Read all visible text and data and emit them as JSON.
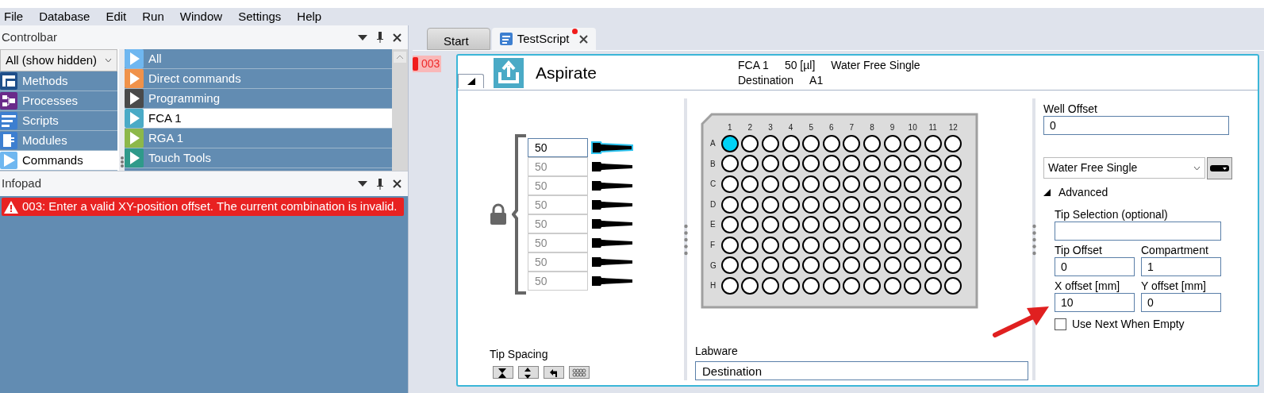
{
  "menu": [
    "File",
    "Database",
    "Edit",
    "Run",
    "Window",
    "Settings",
    "Help"
  ],
  "controlbar": {
    "title": "Controlbar",
    "filter": "All (show hidden)",
    "categories": [
      {
        "label": "Methods",
        "kind": "methods",
        "selected": false
      },
      {
        "label": "Processes",
        "kind": "processes",
        "selected": false
      },
      {
        "label": "Scripts",
        "kind": "scripts",
        "selected": false
      },
      {
        "label": "Modules",
        "kind": "modules",
        "selected": false
      },
      {
        "label": "Commands",
        "kind": "commands",
        "selected": true
      }
    ],
    "commands": [
      {
        "label": "All",
        "color": "#6fb7f0",
        "selected": false
      },
      {
        "label": "Direct commands",
        "color": "#f0924a",
        "selected": false
      },
      {
        "label": "Programming",
        "color": "#4a4a4a",
        "selected": false
      },
      {
        "label": "FCA 1",
        "color": "#4aaac6",
        "selected": true
      },
      {
        "label": "RGA 1",
        "color": "#8db84a",
        "selected": false
      },
      {
        "label": "Touch Tools",
        "color": "#2f9a8a",
        "selected": false
      }
    ]
  },
  "infopad": {
    "title": "Infopad",
    "messages": [
      {
        "text": "003: Enter a valid XY-position offset. The current combination is invalid."
      }
    ]
  },
  "tabs": [
    {
      "label": "Start",
      "selected": false,
      "modified": false,
      "closable": false
    },
    {
      "label": "TestScript",
      "selected": true,
      "modified": true,
      "closable": true
    }
  ],
  "step_marker": "003",
  "step": {
    "title": "Aspirate",
    "expanded": true,
    "summary": [
      [
        "FCA 1",
        "50 [µl]",
        "Water Free Single"
      ],
      [
        "Destination",
        "A1"
      ]
    ],
    "volumes": [
      {
        "value": "50",
        "selected": true
      },
      {
        "value": "50",
        "selected": false
      },
      {
        "value": "50",
        "selected": false
      },
      {
        "value": "50",
        "selected": false
      },
      {
        "value": "50",
        "selected": false
      },
      {
        "value": "50",
        "selected": false
      },
      {
        "value": "50",
        "selected": false
      },
      {
        "value": "50",
        "selected": false
      }
    ],
    "tip_spacing": "Tip Spacing",
    "plate": {
      "columns": [
        "1",
        "2",
        "3",
        "4",
        "5",
        "6",
        "7",
        "8",
        "9",
        "10",
        "11",
        "12"
      ],
      "rows": [
        {
          "label": "A",
          "wells": [
            {
              "selected": true
            },
            {
              "selected": false
            },
            {
              "selected": false
            },
            {
              "selected": false
            },
            {
              "selected": false
            },
            {
              "selected": false
            },
            {
              "selected": false
            },
            {
              "selected": false
            },
            {
              "selected": false
            },
            {
              "selected": false
            },
            {
              "selected": false
            },
            {
              "selected": false
            }
          ]
        },
        {
          "label": "B",
          "wells": [
            {
              "selected": false
            },
            {
              "selected": false
            },
            {
              "selected": false
            },
            {
              "selected": false
            },
            {
              "selected": false
            },
            {
              "selected": false
            },
            {
              "selected": false
            },
            {
              "selected": false
            },
            {
              "selected": false
            },
            {
              "selected": false
            },
            {
              "selected": false
            },
            {
              "selected": false
            }
          ]
        },
        {
          "label": "C",
          "wells": [
            {
              "selected": false
            },
            {
              "selected": false
            },
            {
              "selected": false
            },
            {
              "selected": false
            },
            {
              "selected": false
            },
            {
              "selected": false
            },
            {
              "selected": false
            },
            {
              "selected": false
            },
            {
              "selected": false
            },
            {
              "selected": false
            },
            {
              "selected": false
            },
            {
              "selected": false
            }
          ]
        },
        {
          "label": "D",
          "wells": [
            {
              "selected": false
            },
            {
              "selected": false
            },
            {
              "selected": false
            },
            {
              "selected": false
            },
            {
              "selected": false
            },
            {
              "selected": false
            },
            {
              "selected": false
            },
            {
              "selected": false
            },
            {
              "selected": false
            },
            {
              "selected": false
            },
            {
              "selected": false
            },
            {
              "selected": false
            }
          ]
        },
        {
          "label": "E",
          "wells": [
            {
              "selected": false
            },
            {
              "selected": false
            },
            {
              "selected": false
            },
            {
              "selected": false
            },
            {
              "selected": false
            },
            {
              "selected": false
            },
            {
              "selected": false
            },
            {
              "selected": false
            },
            {
              "selected": false
            },
            {
              "selected": false
            },
            {
              "selected": false
            },
            {
              "selected": false
            }
          ]
        },
        {
          "label": "F",
          "wells": [
            {
              "selected": false
            },
            {
              "selected": false
            },
            {
              "selected": false
            },
            {
              "selected": false
            },
            {
              "selected": false
            },
            {
              "selected": false
            },
            {
              "selected": false
            },
            {
              "selected": false
            },
            {
              "selected": false
            },
            {
              "selected": false
            },
            {
              "selected": false
            },
            {
              "selected": false
            }
          ]
        },
        {
          "label": "G",
          "wells": [
            {
              "selected": false
            },
            {
              "selected": false
            },
            {
              "selected": false
            },
            {
              "selected": false
            },
            {
              "selected": false
            },
            {
              "selected": false
            },
            {
              "selected": false
            },
            {
              "selected": false
            },
            {
              "selected": false
            },
            {
              "selected": false
            },
            {
              "selected": false
            },
            {
              "selected": false
            }
          ]
        },
        {
          "label": "H",
          "wells": [
            {
              "selected": false
            },
            {
              "selected": false
            },
            {
              "selected": false
            },
            {
              "selected": false
            },
            {
              "selected": false
            },
            {
              "selected": false
            },
            {
              "selected": false
            },
            {
              "selected": false
            },
            {
              "selected": false
            },
            {
              "selected": false
            },
            {
              "selected": false
            },
            {
              "selected": false
            }
          ]
        }
      ]
    },
    "labware": {
      "label": "Labware",
      "value": "Destination"
    },
    "well_offset": {
      "label": "Well Offset",
      "value": "0"
    },
    "liquid_class": "Water Free Single",
    "advanced": {
      "label": "Advanced",
      "expanded": true,
      "tip_selection": {
        "label": "Tip Selection (optional)"
      },
      "tip_offset": {
        "label": "Tip Offset",
        "value": "0"
      },
      "compartment": {
        "label": "Compartment",
        "value": "1"
      },
      "x_offset": {
        "label": "X offset [mm]",
        "value": "10"
      },
      "y_offset": {
        "label": "Y offset [mm]",
        "value": "0"
      },
      "use_next_when_empty": {
        "label": "Use Next When Empty",
        "checked": false
      }
    }
  }
}
